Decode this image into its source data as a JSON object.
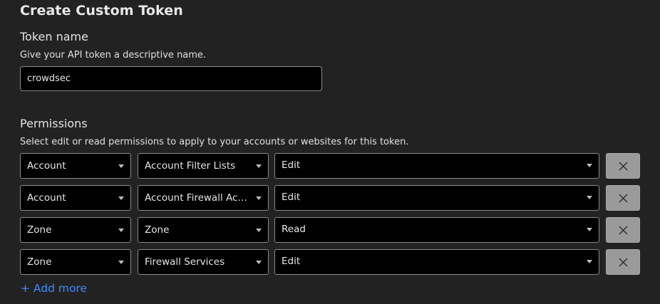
{
  "form": {
    "title": "Create Custom Token",
    "token_name": {
      "label": "Token name",
      "help": "Give your API token a descriptive name.",
      "value": "crowdsec"
    },
    "permissions": {
      "label": "Permissions",
      "help": "Select edit or read permissions to apply to your accounts or websites for this token.",
      "rows": [
        {
          "scope": "Account",
          "item": "Account Filter Lists",
          "level": "Edit"
        },
        {
          "scope": "Account",
          "item": "Account Firewall Acc...",
          "level": "Edit"
        },
        {
          "scope": "Zone",
          "item": "Zone",
          "level": "Read"
        },
        {
          "scope": "Zone",
          "item": "Firewall Services",
          "level": "Edit"
        }
      ],
      "remove_icon": "close-icon",
      "add_more_label": "+ Add more"
    }
  },
  "colors": {
    "background": "#222222",
    "input_background": "#000000",
    "input_border": "#8a8a8a",
    "remove_button": "#9a9a9a",
    "link": "#3d8bff"
  }
}
